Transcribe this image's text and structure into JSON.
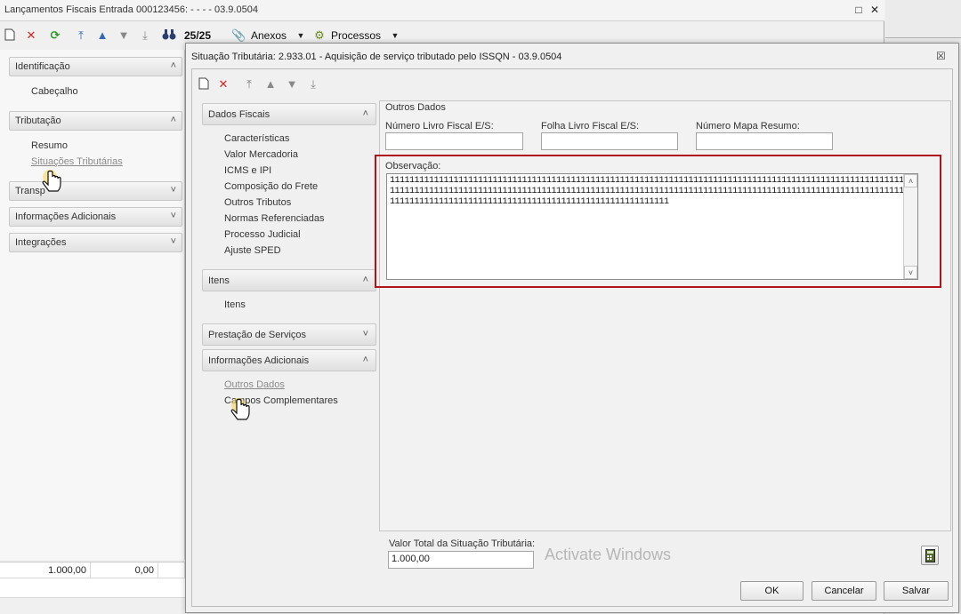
{
  "main_window": {
    "title": "Lançamentos Fiscais Entrada 000123456: - - - - 03.9.0504",
    "toolbar": {
      "record_counter": "25/25",
      "anexos_label": "Anexos",
      "processos_label": "Processos"
    },
    "accordion": {
      "sections": [
        {
          "label": "Identificação",
          "expanded": true,
          "items": [
            "Cabeçalho"
          ]
        },
        {
          "label": "Tributação",
          "expanded": true,
          "items": [
            "Resumo",
            "Situações Tributárias"
          ],
          "active_item": "Situações Tributárias"
        },
        {
          "label": "Transp",
          "expanded": false,
          "items": []
        },
        {
          "label": "Informações Adicionais",
          "expanded": false,
          "items": []
        },
        {
          "label": "Integrações",
          "expanded": false,
          "items": []
        }
      ]
    },
    "bottom_grid": {
      "values": [
        "1.000,00",
        "0,00"
      ]
    }
  },
  "dialog": {
    "title": "Situação Tributária: 2.933.01 - Aquisição de serviço tributado pelo ISSQN - 03.9.0504",
    "nav": {
      "sections": [
        {
          "label": "Dados Fiscais",
          "expanded": true,
          "items": [
            "Características",
            "Valor Mercadoria",
            "ICMS e IPI",
            "Composição do Frete",
            "Outros Tributos",
            "Normas Referenciadas",
            "Processo Judicial",
            "Ajuste SPED"
          ]
        },
        {
          "label": "Itens",
          "expanded": true,
          "items": [
            "Itens"
          ]
        },
        {
          "label": "Prestação de Serviços",
          "expanded": false,
          "items": []
        },
        {
          "label": "Informações Adicionais",
          "expanded": true,
          "items": [
            "Outros Dados",
            "Campos Complementares"
          ],
          "active_item": "Outros Dados"
        }
      ]
    },
    "content": {
      "section_title": "Outros Dados",
      "numero_livro_label": "Número Livro Fiscal E/S:",
      "numero_livro_value": "",
      "folha_livro_label": "Folha Livro Fiscal E/S:",
      "folha_livro_value": "",
      "numero_mapa_label": "Número Mapa Resumo:",
      "numero_mapa_value": "",
      "observacao_label": "Observação:",
      "observacao_value": "111111111111111111111111111111111111111111111111111111111111111111111111111111111111111111111111111111111111111111111111111111111111111111111111111111111111111111111111111111111111111111111111111111111111111111111111111111111111111111111111111111111111111111111111111"
    },
    "footer": {
      "valor_total_label": "Valor Total da Situação Tributária:",
      "valor_total_value": "1.000,00",
      "ok_label": "OK",
      "cancelar_label": "Cancelar",
      "salvar_label": "Salvar"
    }
  },
  "watermark_text": "Activate Windows",
  "colors": {
    "highlight_border": "#b0131c",
    "delete_red": "#d9231f",
    "refresh_green": "#2a9a2a",
    "nav_arrow_blue": "#3467b8"
  }
}
